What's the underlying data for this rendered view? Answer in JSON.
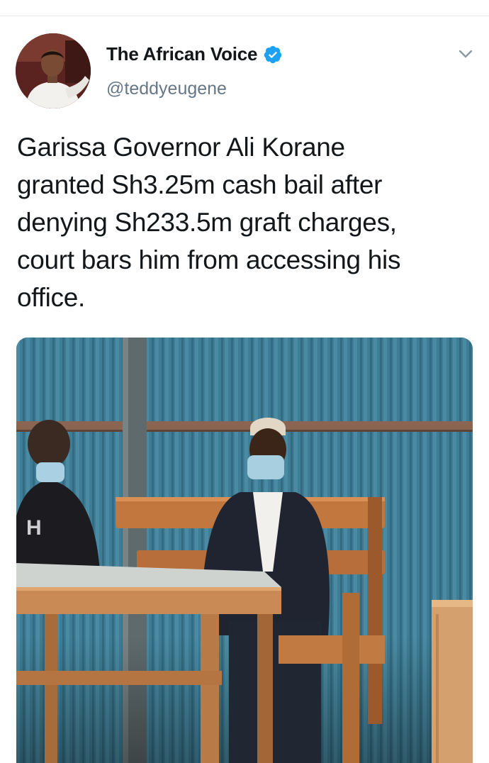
{
  "tweet": {
    "author": {
      "name": "The African Voice",
      "handle": "@teddyeugene",
      "verified": true
    },
    "text": "Garissa Governor Ali Korane\ngranted Sh3.25m cash bail after\ndenying Sh233.5m graft charges,\ncourt bars him from accessing his\noffice.",
    "media": {
      "type": "photo",
      "shirt_logo": "H"
    }
  },
  "icons": {
    "verified": "verified-badge-icon",
    "menu": "chevron-down-icon"
  },
  "colors": {
    "brand_blue": "#1da1f2",
    "name_text": "#14171a",
    "handle_text": "#657786",
    "divider": "#e6ecf0"
  }
}
